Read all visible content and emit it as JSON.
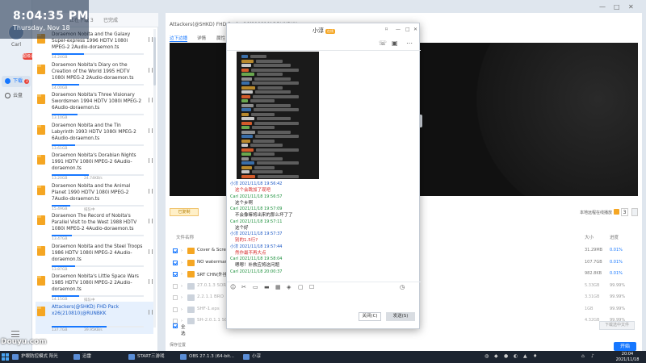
{
  "overlay": {
    "time": "8:04:35 PM",
    "date": "Thursday, Nov 18"
  },
  "watermark": "Douyu.com",
  "user": {
    "name": "Carl",
    "badge": "超级会员"
  },
  "nav": {
    "download": "下载",
    "download_badge": "3",
    "cloud": "云盘"
  },
  "list_tabs": [
    "正在下载 3",
    "已完成"
  ],
  "download_items": [
    {
      "name": "Doraemon Nobita and the Galaxy Super-express 1996 HDTV 1080i MPEG-2 2Audio-doraemon.ts",
      "size": "14.24GB",
      "progress": 0.35
    },
    {
      "name": "Doraemon Nobita's Diary on the Creation of the World 1995 HDTV 1080i MPEG-2 2Audio-doraemon.ts",
      "size": "14.00GB",
      "progress": 0.3
    },
    {
      "name": "Doraemon Nobita's Three Visionary Swordsmen 1994 HDTV 1080i MPEG-2 6Audio-doraemon.ts",
      "size": "13.10GB",
      "progress": 0.28
    },
    {
      "name": "Doraemon Nobita and the Tin Labyrinth 1993 HDTV 1080i MPEG-2 6Audio-doraemon.ts",
      "size": "13.61GB",
      "progress": 0.25
    },
    {
      "name": "Doraemon Nobita's Dorabian Nights 1991 HDTV 1080i MPEG-2 6Audio-doraemon.ts",
      "size": "13.20GB",
      "progress": 0.4,
      "speed": "24.74KB/s"
    },
    {
      "name": "Doraemon Nobita and the Animal Planet 1990 HDTV 1080i MPEG-2 7Audio-doraemon.ts",
      "size": "15.49GB",
      "progress": 0.2,
      "status": "排队中"
    },
    {
      "name": "Doraemon The Record of Nobita's Parallel Visit to the West 1988 HDTV 1080i MPEG-2 4Audio-doraemon.ts",
      "size": "13.47GB",
      "progress": 0.22
    },
    {
      "name": "Doraemon Nobita and the Steel Troops 1986 HDTV 1080i MPEG-2 4Audio-doraemon.ts",
      "size": "13.87GB",
      "progress": 0.25
    },
    {
      "name": "Doraemon Nobita's Little Space Wars 1985 HDTV 1080i MPEG-2 2Audio-doraemon.ts",
      "size": "14.15GB",
      "progress": 0.3,
      "status": "排队中"
    },
    {
      "name": "Attackers(@SHKD) FHD Pack x26(210810)@RUNBKK",
      "size": "137.7GB",
      "progress": 0.6,
      "speed": "39.95KB/s"
    }
  ],
  "main": {
    "title": "Attackers(@SHKD) FHD Pack x26(210810)@RUNBKK",
    "tabs": [
      "边下边播",
      "详情",
      "属性"
    ],
    "copy_label": "已复制",
    "remote_label": "本地远程在线播放",
    "remote_count": "3",
    "headers": {
      "name": "文件名称",
      "size": "大小",
      "progress": "进度"
    },
    "files": [
      {
        "name": "Cover & Screen",
        "size": "31.29MB",
        "progress": "0.01%",
        "checked": true
      },
      {
        "name": "NO watermarked",
        "size": "107.7GB",
        "progress": "0.01%",
        "checked": true
      },
      {
        "name": "SRT CHN(外挂字幕)",
        "size": "982.8KB",
        "progress": "0.01%",
        "checked": true
      },
      {
        "name": "27.0.1.3 SORRIER",
        "size": "5.33GB",
        "progress": "99.99%",
        "checked": false
      },
      {
        "name": "2.2.1.1 BRO",
        "size": "3.31GB",
        "progress": "99.99%",
        "checked": false
      },
      {
        "name": "SHF-1.eps",
        "size": "1GB",
        "progress": "99.99%",
        "checked": false
      },
      {
        "name": "SH-2.0.1.1 SOPRANO",
        "size": "4.32GB",
        "progress": "99.99%",
        "checked": false
      }
    ],
    "select_all": "全选",
    "download_selected": "下载选中文件",
    "save_location": "保存位置",
    "start_button": "开始"
  },
  "chat": {
    "title": "小淳",
    "title_badge": "在线",
    "messages": [
      {
        "who": "小淳",
        "ts": "2021/11/18 19:56:42",
        "text": "这个会跳加了现吧",
        "kind": "other",
        "red": true
      },
      {
        "who": "Carl",
        "ts": "2021/11/18 19:56:57",
        "text": "这个乡啊",
        "kind": "me"
      },
      {
        "who": "Carl",
        "ts": "2021/11/18 19:57:09",
        "text": "不会像嘛将出来的那么坏了了",
        "kind": "me"
      },
      {
        "who": "Carl",
        "ts": "2021/11/18 19:57:11",
        "text": "这个好",
        "kind": "me"
      },
      {
        "who": "小淳",
        "ts": "2021/11/18 19:57:37",
        "text": "别的1.5行?",
        "kind": "other",
        "red": true
      },
      {
        "who": "小淳",
        "ts": "2021/11/18 19:57:44",
        "text": "然作最不再大点",
        "kind": "other",
        "red": true
      },
      {
        "who": "Carl",
        "ts": "2021/11/18 19:58:04",
        "text": "嗯嗯！补救应将这问题",
        "kind": "me"
      },
      {
        "who": "Carl",
        "ts": "2021/11/18 20:00:37",
        "text": "",
        "kind": "me"
      }
    ],
    "close_label": "关闭(C)",
    "send_label": "发送(S)"
  },
  "taskbar": {
    "items": [
      "护眼防控模式 阳光",
      "迅雷",
      "START三游戏",
      "OBS 27.1.3 (64-bit...",
      "小淳"
    ],
    "time": "20:04",
    "date": "2021/11/18"
  },
  "colors": {
    "accent": "#1677ff",
    "folder": "#f5a623",
    "me": "#1a8f3a",
    "other": "#1a57c4",
    "alert": "#d62828"
  }
}
